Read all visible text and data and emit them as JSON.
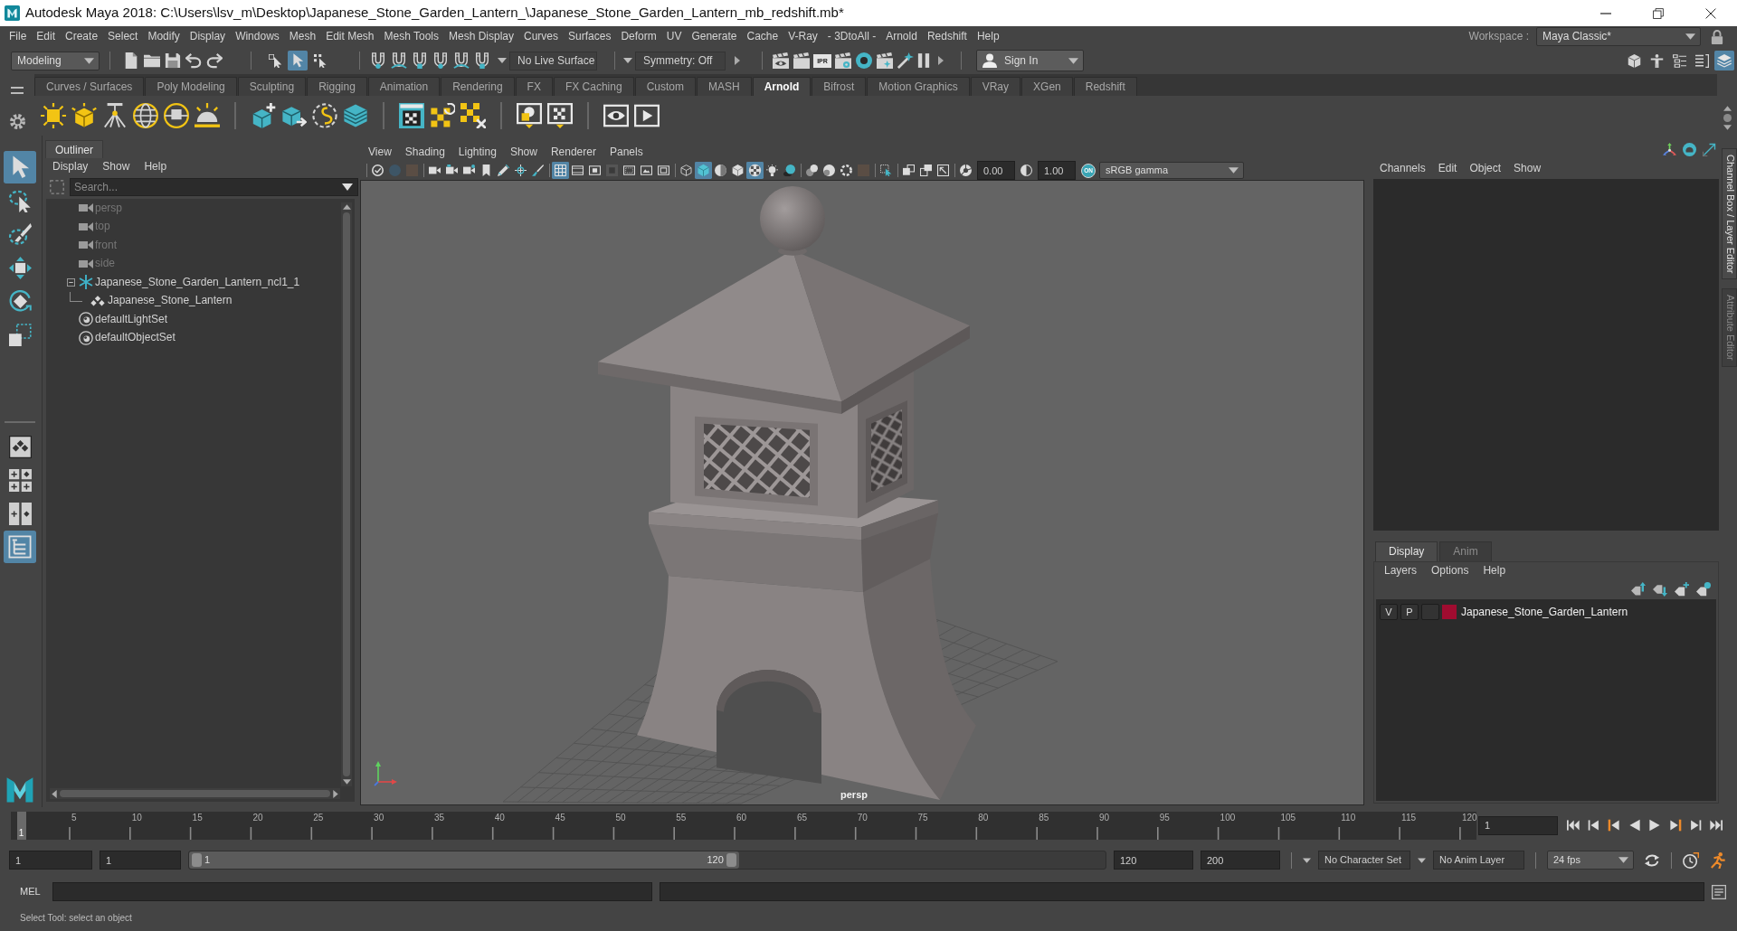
{
  "window": {
    "title": "Autodesk Maya 2018: C:\\Users\\lsv_m\\Desktop\\Japanese_Stone_Garden_Lantern_\\Japanese_Stone_Garden_Lantern_mb_redshift.mb*"
  },
  "menu_bar": {
    "items": [
      "File",
      "Edit",
      "Create",
      "Select",
      "Modify",
      "Display",
      "Windows",
      "Mesh",
      "Edit Mesh",
      "Mesh Tools",
      "Mesh Display",
      "Curves",
      "Surfaces",
      "Deform",
      "UV",
      "Generate",
      "Cache",
      "V-Ray",
      "- 3DtoAll -",
      "Arnold",
      "Redshift",
      "Help"
    ],
    "workspace_label": "Workspace :",
    "workspace": "Maya Classic*"
  },
  "status_line": {
    "menu_set": "Modeling",
    "selection_modes": [
      {
        "selected": false
      },
      {
        "selected": true
      },
      {
        "selected": false
      }
    ],
    "live_surface": "No Live Surface",
    "symmetry": "Symmetry: Off",
    "ipr": "IPR",
    "sign_in": "Sign In",
    "panel_toggles": [
      {
        "on": false
      },
      {
        "on": false
      },
      {
        "on": false
      },
      {
        "on": false
      },
      {
        "on": true
      }
    ]
  },
  "shelf": {
    "tabs": [
      {
        "label": "Curves / Surfaces",
        "selected": false
      },
      {
        "label": "Poly Modeling",
        "selected": false
      },
      {
        "label": "Sculpting",
        "selected": false
      },
      {
        "label": "Rigging",
        "selected": false
      },
      {
        "label": "Animation",
        "selected": false
      },
      {
        "label": "Rendering",
        "selected": false
      },
      {
        "label": "FX",
        "selected": false
      },
      {
        "label": "FX Caching",
        "selected": false
      },
      {
        "label": "Custom",
        "selected": false
      },
      {
        "label": "MASH",
        "selected": false
      },
      {
        "label": "Arnold",
        "selected": true
      },
      {
        "label": "Bifrost",
        "selected": false
      },
      {
        "label": "Motion Graphics",
        "selected": false
      },
      {
        "label": "VRay",
        "selected": false
      },
      {
        "label": "XGen",
        "selected": false
      },
      {
        "label": "Redshift",
        "selected": false
      }
    ]
  },
  "toolbox": {
    "tools": [
      {
        "selected": true
      },
      {
        "selected": false
      },
      {
        "selected": false
      },
      {
        "selected": false
      },
      {
        "selected": false
      },
      {
        "selected": false
      }
    ],
    "layouts": [
      {
        "selected": false
      },
      {
        "selected": false
      },
      {
        "selected": false
      },
      {
        "selected": true
      }
    ]
  },
  "outliner": {
    "title": "Outliner",
    "menu": [
      "Display",
      "Show",
      "Help"
    ],
    "search": {
      "placeholder": "Search..."
    },
    "items": [
      {
        "label": "persp",
        "kind": "camera",
        "dimmed": true
      },
      {
        "label": "top",
        "kind": "camera",
        "dimmed": true
      },
      {
        "label": "front",
        "kind": "camera",
        "dimmed": true
      },
      {
        "label": "side",
        "kind": "camera",
        "dimmed": true
      },
      {
        "label": "Japanese_Stone_Garden_Lantern_ncl1_1",
        "kind": "group",
        "dimmed": false,
        "expanded": true,
        "children": [
          {
            "label": "Japanese_Stone_Lantern",
            "kind": "mesh",
            "dimmed": false
          }
        ]
      },
      {
        "label": "defaultLightSet",
        "kind": "set",
        "dimmed": false
      },
      {
        "label": "defaultObjectSet",
        "kind": "set",
        "dimmed": false
      }
    ]
  },
  "viewport": {
    "menu": [
      "View",
      "Shading",
      "Lighting",
      "Show",
      "Renderer",
      "Panels"
    ],
    "toolbar": [
      {
        "on": false
      },
      {
        "on": false
      },
      {
        "on": false
      },
      {
        "on": false
      },
      {
        "on": false
      },
      {
        "on": false
      },
      {
        "on": false
      },
      {
        "on": false
      },
      {
        "on": false
      },
      {
        "on": false
      },
      {
        "on": true
      },
      {
        "on": false
      },
      {
        "on": false
      },
      {
        "on": false
      },
      {
        "on": false
      },
      {
        "on": false
      },
      {
        "on": false
      },
      {
        "on": false
      },
      {
        "on": true
      },
      {
        "on": false
      },
      {
        "on": false
      },
      {
        "on": true
      },
      {
        "on": false
      },
      {
        "on": false
      },
      {
        "on": false
      },
      {
        "on": false
      },
      {
        "on": false
      },
      {
        "on": false
      },
      {
        "on": false
      },
      {
        "on": false
      },
      {
        "on": false
      },
      {
        "on": false
      },
      {
        "on": false
      },
      {
        "on": false
      }
    ],
    "exposure": "0.00",
    "gamma": "1.00",
    "color_management": "ON",
    "view_transform": "sRGB gamma",
    "camera": "persp"
  },
  "channel_box": {
    "menu": [
      "Channels",
      "Edit",
      "Object",
      "Show"
    ]
  },
  "layer_editor": {
    "tabs": [
      {
        "label": "Display",
        "selected": true
      },
      {
        "label": "Anim",
        "selected": false
      }
    ],
    "menu": [
      "Layers",
      "Options",
      "Help"
    ],
    "layers": [
      {
        "visibility": "V",
        "playback": "P",
        "color": "#a00c30",
        "name": "Japanese_Stone_Garden_Lantern"
      }
    ]
  },
  "side_tabs": [
    {
      "label": "Channel Box / Layer Editor",
      "selected": true
    },
    {
      "label": "Attribute Editor",
      "selected": false
    }
  ],
  "time_slider": {
    "ticks": [
      "5",
      "10",
      "15",
      "20",
      "25",
      "30",
      "35",
      "40",
      "45",
      "50",
      "55",
      "60",
      "65",
      "70",
      "75",
      "80",
      "85",
      "90",
      "95",
      "100",
      "105",
      "110",
      "115",
      "120"
    ],
    "marker": "1",
    "level": 0,
    "current_frame": "1"
  },
  "range_slider": {
    "start": "1",
    "playback_start": "1",
    "range_start": "1",
    "range_end": "120",
    "level": 0.6,
    "playback_end": "120",
    "end": "200",
    "character_set": "No Character Set",
    "anim_layer": "No Anim Layer",
    "fps": "24 fps"
  },
  "command_line": {
    "language": "MEL"
  },
  "help_line": "Select Tool: select an object"
}
